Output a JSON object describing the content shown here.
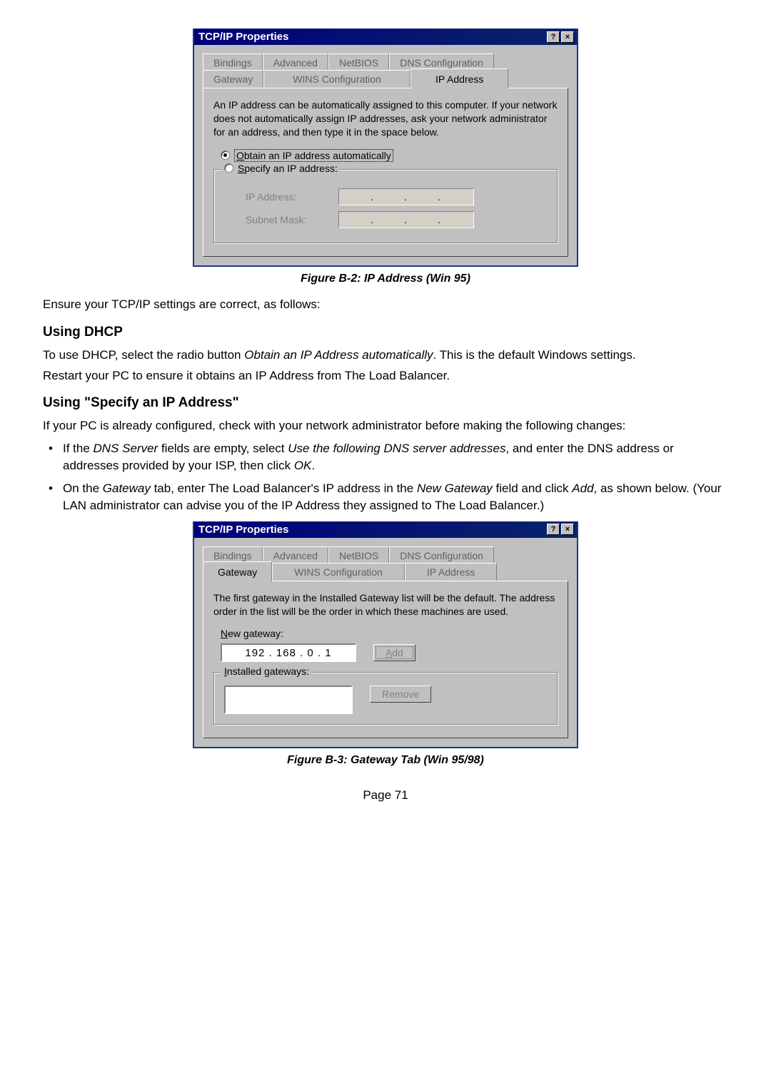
{
  "dialog1": {
    "title": "TCP/IP Properties",
    "tabs": {
      "bindings": "Bindings",
      "advanced": "Advanced",
      "netbios": "NetBIOS",
      "dns": "DNS Configuration",
      "gateway": "Gateway",
      "wins": "WINS Configuration",
      "ip": "IP Address"
    },
    "desc": "An IP address can be automatically assigned to this computer. If your network does not automatically assign IP addresses, ask your network administrator for an address, and then type it in the space below.",
    "radio_obtain_pre": "O",
    "radio_obtain_post": "btain an IP address automatically",
    "radio_specify_pre": "S",
    "radio_specify_post": "pecify an IP address:",
    "ip_label_pre": "I",
    "ip_label_post": "P Address:",
    "subnet_label_pre": "S",
    "subnet_label_mid": "u",
    "subnet_label_post": "bnet Mask:"
  },
  "caption1": "Figure B-2: IP Address (Win 95)",
  "para1": "Ensure your TCP/IP settings are correct, as follows:",
  "h_dhcp": "Using DHCP",
  "para2a": "To use DHCP, select the radio button ",
  "para2b": "Obtain an IP Address automatically",
  "para2c": ". This is the default Windows settings.",
  "para3": "Restart your PC to ensure it obtains an IP Address from The Load Balancer.",
  "h_specify": "Using \"Specify an IP Address\"",
  "para4": "If your PC is already configured, check with your network administrator before making the following changes:",
  "bullet1a": "If the ",
  "bullet1b": "DNS Server",
  "bullet1c": " fields are empty, select ",
  "bullet1d": "Use the following DNS server addresses",
  "bullet1e": ", and enter the DNS address or addresses provided by your ISP, then click ",
  "bullet1f": "OK",
  "bullet1g": ".",
  "bullet2a": "On the ",
  "bullet2b": "Gateway",
  "bullet2c": " tab, enter The Load Balancer's IP address in the ",
  "bullet2d": "New Gateway",
  "bullet2e": " field and click ",
  "bullet2f": "Add",
  "bullet2g": ", as shown below. (Your LAN administrator can advise you of the IP Address they assigned to The Load Balancer.)",
  "dialog2": {
    "title": "TCP/IP Properties",
    "tabs": {
      "bindings": "Bindings",
      "advanced": "Advanced",
      "netbios": "NetBIOS",
      "dns": "DNS Configuration",
      "gateway": "Gateway",
      "wins": "WINS Configuration",
      "ip": "IP Address"
    },
    "desc": "The first gateway in the Installed Gateway list will be the default. The address order in the list will be the order in which these machines are used.",
    "new_gw_pre": "N",
    "new_gw_post": "ew gateway:",
    "ip_value": "192 . 168 .  0  .   1",
    "add_pre": "A",
    "add_post": "dd",
    "installed_pre": "I",
    "installed_post": "nstalled gateways:",
    "remove_pre": "R",
    "remove_post": "emove"
  },
  "caption2": "Figure B-3: Gateway Tab (Win 95/98)",
  "page_num": "Page 71"
}
